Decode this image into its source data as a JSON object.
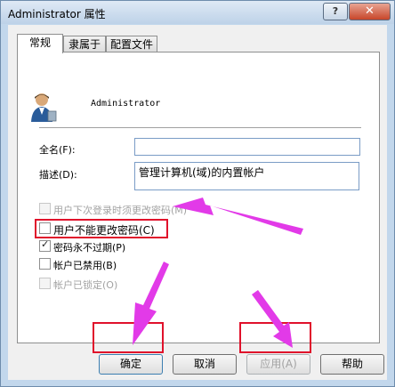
{
  "window": {
    "title": "Administrator 属性",
    "help_glyph": "?",
    "close_glyph": "✕"
  },
  "tabs": [
    {
      "label": "常规",
      "active": true
    },
    {
      "label": "隶属于",
      "active": false
    },
    {
      "label": "配置文件",
      "active": false
    }
  ],
  "general": {
    "username": "Administrator",
    "fullname_label": "全名(F):",
    "fullname_value": "",
    "description_label": "描述(D):",
    "description_value": "管理计算机(域)的内置帐户"
  },
  "options": [
    {
      "label": "用户下次登录时须更改密码(M)",
      "checked": false,
      "enabled": false
    },
    {
      "label": "用户不能更改密码(C)",
      "checked": false,
      "enabled": true
    },
    {
      "label": "密码永不过期(P)",
      "checked": true,
      "enabled": true
    },
    {
      "label": "帐户已禁用(B)",
      "checked": false,
      "enabled": true
    },
    {
      "label": "帐户已锁定(O)",
      "checked": false,
      "enabled": false
    }
  ],
  "buttons": {
    "ok": "确定",
    "cancel": "取消",
    "apply": "应用(A)",
    "help": "帮助"
  },
  "colors": {
    "annotation_box": "#e0112b",
    "annotation_arrow": "#e23ae8"
  }
}
